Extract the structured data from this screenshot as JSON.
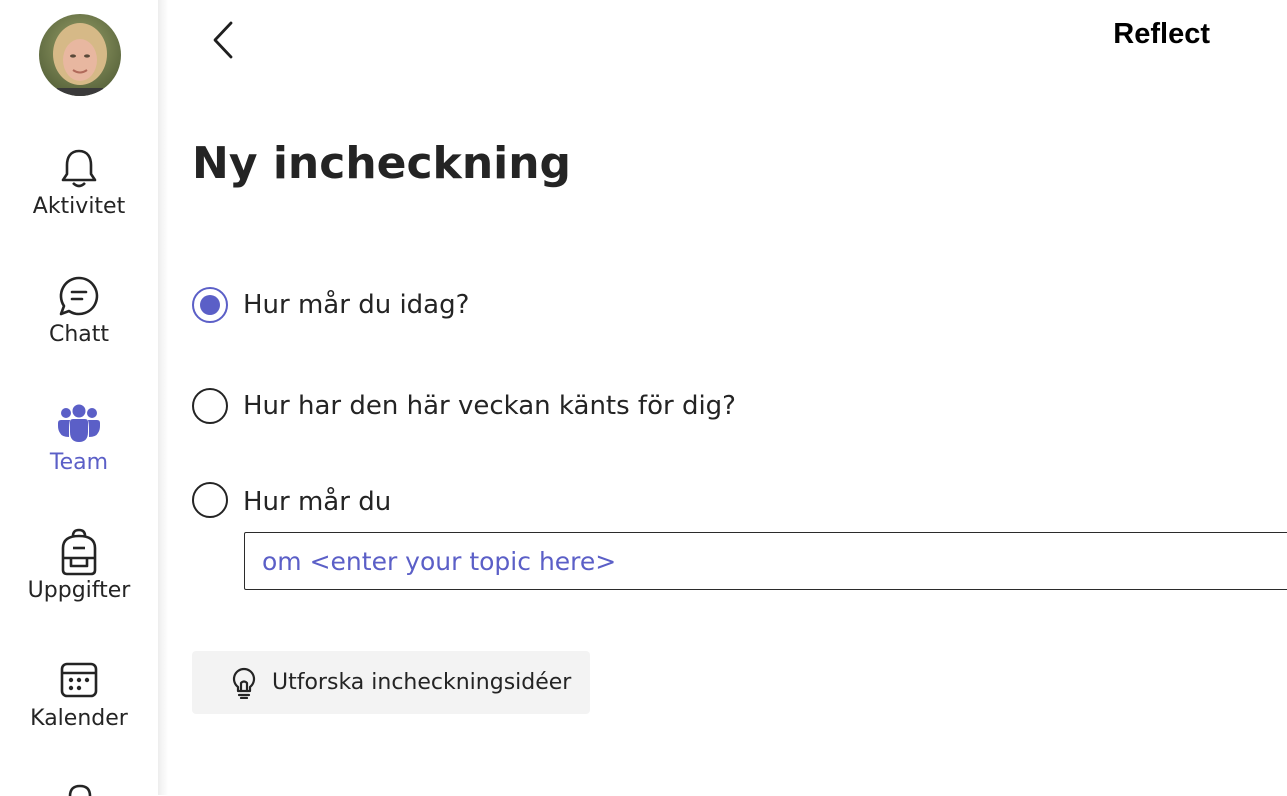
{
  "app": {
    "title": "Reflect"
  },
  "rail": {
    "items": [
      {
        "label": "Aktivitet",
        "icon": "bell-icon",
        "active": false
      },
      {
        "label": "Chatt",
        "icon": "chat-bubble-icon",
        "active": false
      },
      {
        "label": "Team",
        "icon": "teams-people-icon",
        "active": true
      },
      {
        "label": "Uppgifter",
        "icon": "backpack-icon",
        "active": false
      },
      {
        "label": "Kalender",
        "icon": "calendar-icon",
        "active": false
      }
    ]
  },
  "main": {
    "title": "Ny incheckning",
    "options": [
      {
        "label": "Hur mår du idag?",
        "checked": true
      },
      {
        "label": "Hur har den här veckan känts för dig?",
        "checked": false
      },
      {
        "label": "Hur mår du",
        "checked": false
      }
    ],
    "topic_input": {
      "value": "om <enter your topic here>"
    },
    "explore_button": {
      "label": "Utforska incheckningsidéer",
      "icon": "lightbulb-icon"
    }
  },
  "colors": {
    "accent": "#5b5fc7",
    "text": "#242424",
    "button_bg": "#f3f3f3"
  }
}
